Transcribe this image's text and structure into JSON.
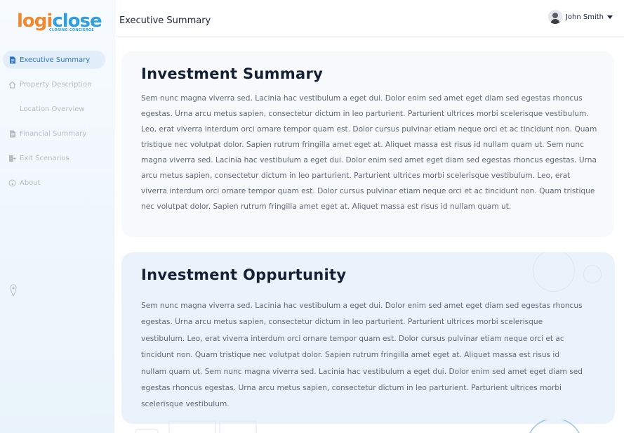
{
  "brand": {
    "logo_part1": "logi",
    "logo_part2": "close",
    "tagline": "CLOSING CONCIERGE",
    "color_orange": "#f0882f",
    "color_blue": "#2f9fe0"
  },
  "sidebar": {
    "items": [
      {
        "label": "Executive Summary",
        "icon": "document-icon",
        "active": true
      },
      {
        "label": "Property Description",
        "icon": "home-icon",
        "active": false
      },
      {
        "label": "Location Overview",
        "icon": "",
        "active": false
      },
      {
        "label": "Financial Summary",
        "icon": "document-icon",
        "active": false
      },
      {
        "label": "Exit Scenarios",
        "icon": "exit-icon",
        "active": false
      },
      {
        "label": "About",
        "icon": "info-icon",
        "active": false
      }
    ]
  },
  "header": {
    "title": "Executive Summary",
    "user_name": "John Smith"
  },
  "sections": {
    "summary_title": "Investment Summary",
    "summary_text": "Sem nunc magna viverra sed. Lacinia hac vestibulum a eget dui. Dolor enim sed amet eget diam sed egestas rhoncus egestas. Urna arcu metus sapien, consectetur dictum in leo parturient. Parturient ultrices morbi scelerisque vestibulum. Leo, erat viverra interdum orci ornare tempor quam est. Dolor cursus pulvinar etiam neque orci et ac tincidunt non. Quam tristique nec volutpat dolor. Sapien rutrum fringilla amet eget at. Aliquet massa est risus id nullam quam ut. Sem nunc magna viverra sed. Lacinia hac vestibulum a eget dui. Dolor enim sed amet eget diam sed egestas rhoncus egestas. Urna arcu metus sapien, consectetur dictum in leo parturient. Parturient ultrices morbi scelerisque vestibulum. Leo, erat viverra interdum orci ornare tempor quam est. Dolor cursus pulvinar etiam neque orci et ac tincidunt non. Quam tristique nec volutpat dolor. Sapien rutrum fringilla amet eget at. Aliquet massa est risus id nullam quam ut.",
    "opportunity_title": "Investment Oppurtunity",
    "opportunity_text": "Sem nunc magna viverra sed. Lacinia hac vestibulum a eget dui. Dolor enim sed amet eget diam sed egestas rhoncus egestas. Urna arcu metus sapien, consectetur dictum in leo parturient. Parturient ultrices morbi scelerisque vestibulum. Leo, erat viverra interdum orci ornare tempor quam est. Dolor cursus pulvinar etiam neque orci et ac tincidunt non. Quam tristique nec volutpat dolor. Sapien rutrum fringilla amet eget at. Aliquet massa est risus id nullam quam ut. Sem nunc magna viverra sed. Lacinia hac vestibulum a eget dui. Dolor enim sed amet eget diam sed egestas rhoncus egestas. Urna arcu metus sapien, consectetur dictum in leo parturient. Parturient ultrices morbi scelerisque vestibulum."
  }
}
